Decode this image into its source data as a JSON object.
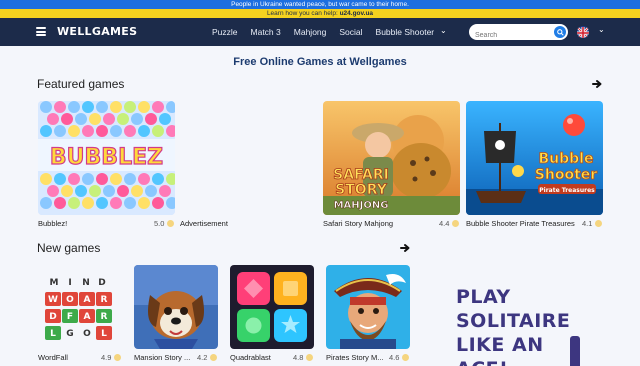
{
  "banner": {
    "line1": "People in Ukraine wanted peace, but war came to their home.",
    "line2_prefix": "Learn how you can help: ",
    "line2_link": "u24.gov.ua"
  },
  "header": {
    "logo": "WELLGAMES",
    "nav": [
      "Puzzle",
      "Match 3",
      "Mahjong",
      "Social",
      "Bubble Shooter"
    ],
    "search_placeholder": "Search"
  },
  "page_title": "Free Online Games at Wellgames",
  "featured": {
    "title": "Featured games",
    "cards": [
      {
        "name": "Bubblez!",
        "rating": "5.0",
        "advertisement": "Advertisement"
      },
      {
        "name": "Safari Story Mahjong",
        "rating": "4.4"
      },
      {
        "name": "Bubble Shooter Pirate Treasures",
        "rating": "4.1"
      }
    ]
  },
  "new_games": {
    "title": "New games",
    "cards": [
      {
        "name": "WordFall",
        "rating": "4.9"
      },
      {
        "name": "Mansion Story ...",
        "rating": "4.2"
      },
      {
        "name": "Quadrablast",
        "rating": "4.8"
      },
      {
        "name": "Pirates Story M...",
        "rating": "4.6"
      }
    ]
  },
  "thumbnails": {
    "bubblez_logo": "BUBBLEZ",
    "safari_line1": "SAFARI",
    "safari_line2": "STORY",
    "safari_line3": "MAHJONG",
    "bubble_shooter_line1": "Bubble",
    "bubble_shooter_line2": "Shooter",
    "bubble_shooter_line3": "Pirate Treasures",
    "wordfall_grid": [
      "M",
      "I",
      "N",
      "D",
      "W",
      "O",
      "A",
      "R",
      "D",
      "F",
      "A",
      "R",
      "L",
      "G",
      "O",
      "L",
      "L"
    ]
  },
  "promo": {
    "line1": "PLAY",
    "line2": "SOLITAIRE",
    "line3": "LIKE AN",
    "line4": "ACE!"
  },
  "colors": {
    "banner_blue": "#1d6fe0",
    "banner_yellow": "#f4d21f",
    "header": "#1c2b4a",
    "accent": "#1f7de6",
    "star": "#f5c84a",
    "promo_text": "#3d3680"
  }
}
